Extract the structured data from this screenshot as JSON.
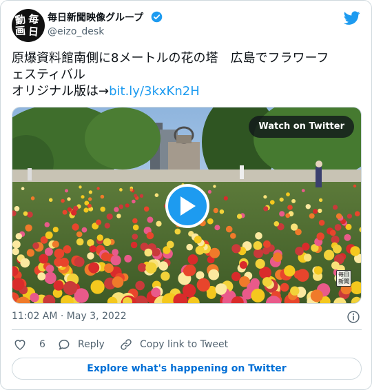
{
  "author": {
    "display_name": "毎日新聞映像グループ",
    "handle": "@eizo_desk",
    "avatar_glyphs": [
      "動",
      "毎",
      "画",
      "日"
    ],
    "verified": true
  },
  "tweet": {
    "line1": "原爆資料館南側に8メートルの花の塔　広島でフラワーフ",
    "line2": "ェスティバル",
    "line3_prefix": "オリジナル版は→",
    "link": "bit.ly/3kxKn2H"
  },
  "media": {
    "watch_label": "Watch on Twitter",
    "watermark": [
      "毎日",
      "新聞"
    ]
  },
  "meta": {
    "timestamp": "11:02 AM · May 3, 2022"
  },
  "actions": {
    "like_count": "6",
    "reply_label": "Reply",
    "copy_label": "Copy link to Tweet"
  },
  "explore_label": "Explore what's happening on Twitter",
  "colors": {
    "accent": "#1d9bf0",
    "muted": "#536471",
    "border": "#cfd9de"
  }
}
